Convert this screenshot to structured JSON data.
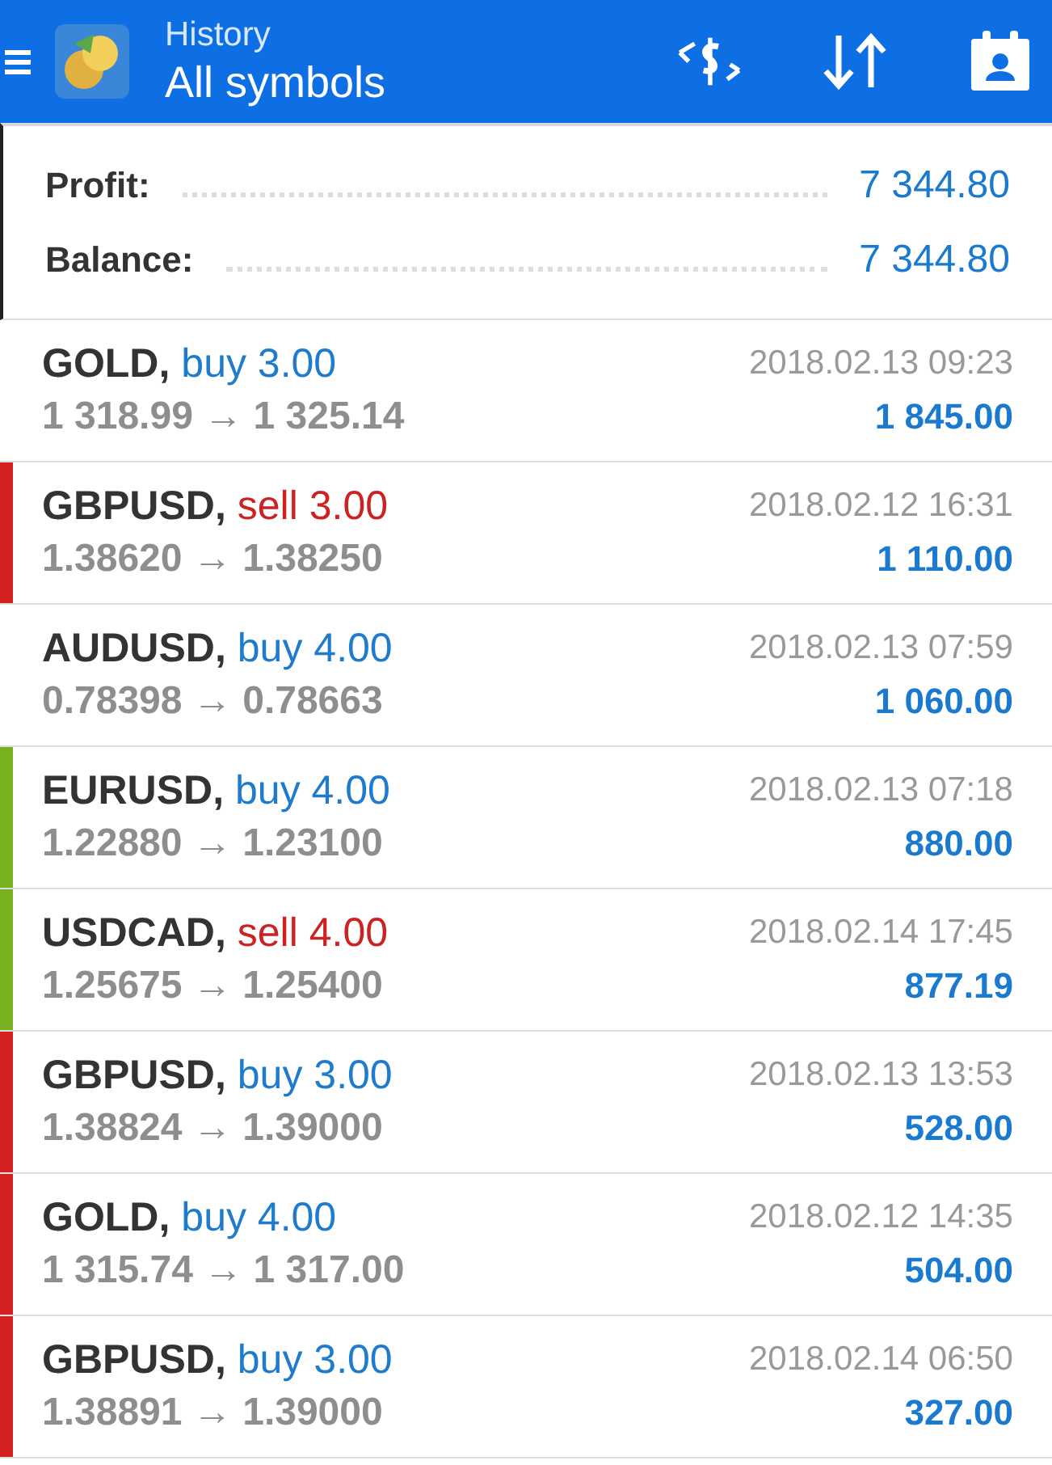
{
  "header": {
    "title": "History",
    "subtitle": "All symbols"
  },
  "summary": [
    {
      "label": "Profit:",
      "value": "7 344.80"
    },
    {
      "label": "Balance:",
      "value": "7 344.80"
    }
  ],
  "trades": [
    {
      "symbol": "GOLD,",
      "sell": false,
      "side": "buy 3.00",
      "prices": "1 318.99 → 1 325.14",
      "time": "2018.02.13 09:23",
      "profit": "1 845.00"
    },
    {
      "symbol": "GBPUSD,",
      "sell": true,
      "side": "sell 3.00",
      "prices": "1.38620 → 1.38250",
      "time": "2018.02.12 16:31",
      "profit": "1 110.00",
      "color": "#d42020"
    },
    {
      "symbol": "AUDUSD,",
      "sell": false,
      "side": "buy 4.00",
      "prices": "0.78398 → 0.78663",
      "time": "2018.02.13 07:59",
      "profit": "1 060.00"
    },
    {
      "symbol": "EURUSD,",
      "sell": false,
      "side": "buy 4.00",
      "prices": "1.22880 → 1.23100",
      "time": "2018.02.13 07:18",
      "profit": "880.00",
      "color": "#78b020"
    },
    {
      "symbol": "USDCAD,",
      "sell": true,
      "side": "sell 4.00",
      "prices": "1.25675 → 1.25400",
      "time": "2018.02.14 17:45",
      "profit": "877.19",
      "color": "#78b020"
    },
    {
      "symbol": "GBPUSD,",
      "sell": false,
      "side": "buy 3.00",
      "prices": "1.38824 → 1.39000",
      "time": "2018.02.13 13:53",
      "profit": "528.00",
      "color": "#d42020"
    },
    {
      "symbol": "GOLD,",
      "sell": false,
      "side": "buy 4.00",
      "prices": "1 315.74 → 1 317.00",
      "time": "2018.02.12 14:35",
      "profit": "504.00",
      "color": "#d42020"
    },
    {
      "symbol": "GBPUSD,",
      "sell": false,
      "side": "buy 3.00",
      "prices": "1.38891 → 1.39000",
      "time": "2018.02.14 06:50",
      "profit": "327.00",
      "color": "#d42020"
    }
  ]
}
